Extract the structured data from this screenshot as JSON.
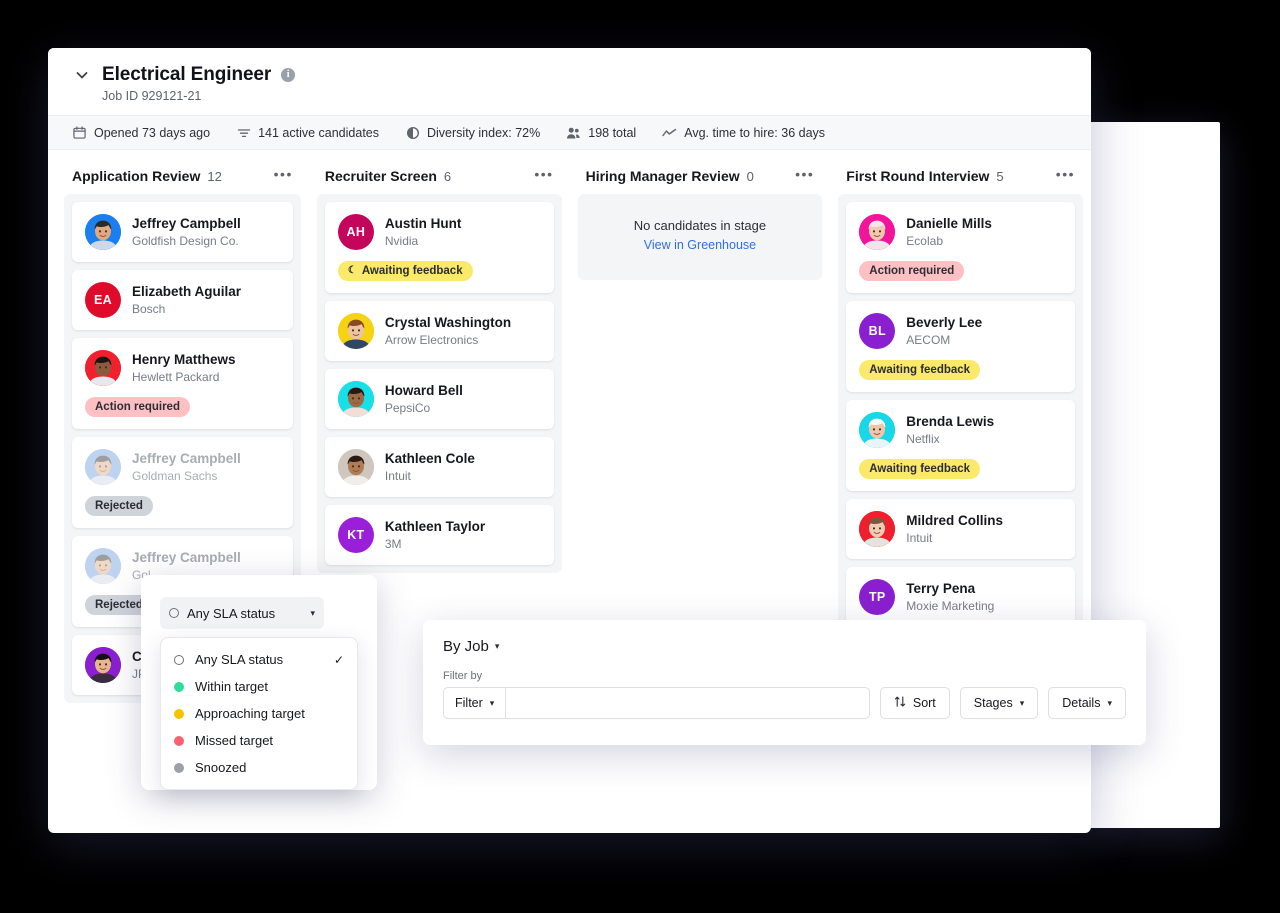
{
  "header": {
    "title": "Electrical Engineer",
    "job_id": "Job ID 929121-21",
    "info_glyph": "i",
    "chevron": "chevron-down"
  },
  "stats": [
    {
      "icon": "calendar-icon",
      "label": "Opened 73 days ago"
    },
    {
      "icon": "filter-icon",
      "label": "141 active candidates"
    },
    {
      "icon": "diversity-icon",
      "label": "Diversity index: 72%"
    },
    {
      "icon": "people-icon",
      "label": "198 total"
    },
    {
      "icon": "trend-icon",
      "label": "Avg. time to hire: 36 days"
    }
  ],
  "columns": [
    {
      "name": "Application Review",
      "count": "12",
      "menu": "•••",
      "empty": null,
      "cards": [
        {
          "name": "Jeffrey Campbell",
          "company": "Goldfish Design Co.",
          "initials": "",
          "avatar_color": "#1b7ff0",
          "photo": "male-1",
          "badge": null,
          "badge_type": null,
          "dim": false
        },
        {
          "name": "Elizabeth Aguilar",
          "company": "Bosch",
          "initials": "EA",
          "avatar_color": "#e00b2a",
          "photo": null,
          "badge": null,
          "badge_type": null,
          "dim": false
        },
        {
          "name": "Henry Matthews",
          "company": "Hewlett Packard",
          "initials": "",
          "avatar_color": "#f0202f",
          "photo": "male-2",
          "badge": "Action required",
          "badge_type": "action",
          "dim": false
        },
        {
          "name": "Jeffrey Campbell",
          "company": "Goldman Sachs",
          "initials": "",
          "avatar_color": "#6f9fe0",
          "photo": "male-1",
          "badge": "Rejected",
          "badge_type": "reject",
          "dim": true
        },
        {
          "name": "Jeffrey Campbell",
          "company": "Gol",
          "initials": "",
          "avatar_color": "#6f9fe0",
          "photo": "male-1",
          "badge": "Rejected",
          "badge_type": "reject",
          "dim": true
        },
        {
          "name": "Cat",
          "company": "JPM",
          "initials": "",
          "avatar_color": "#8a1fd0",
          "photo": "female-1",
          "badge": null,
          "badge_type": null,
          "dim": false
        }
      ]
    },
    {
      "name": "Recruiter Screen",
      "count": "6",
      "menu": "•••",
      "empty": null,
      "cards": [
        {
          "name": "Austin Hunt",
          "company": "Nvidia",
          "initials": "AH",
          "avatar_color": "#c4055c",
          "photo": null,
          "badge": "Awaiting feedback",
          "badge_type": "await",
          "badge_icon": "☾",
          "dim": false
        },
        {
          "name": "Crystal Washington",
          "company": "Arrow Electronics",
          "initials": "",
          "avatar_color": "#f5d312",
          "photo": "female-2",
          "badge": null,
          "badge_type": null,
          "dim": false
        },
        {
          "name": "Howard Bell",
          "company": "PepsiCo",
          "initials": "",
          "avatar_color": "#18e0e8",
          "photo": "male-3",
          "badge": null,
          "badge_type": null,
          "dim": false
        },
        {
          "name": "Kathleen Cole",
          "company": "Intuit",
          "initials": "",
          "avatar_color": "#cfc6bd",
          "photo": "female-3",
          "badge": null,
          "badge_type": null,
          "dim": false
        },
        {
          "name": "Kathleen Taylor",
          "company": "3M",
          "initials": "KT",
          "avatar_color": "#9a1fd8",
          "photo": null,
          "badge": null,
          "badge_type": null,
          "dim": false
        }
      ]
    },
    {
      "name": "Hiring Manager Review",
      "count": "0",
      "menu": "•••",
      "empty": {
        "message": "No candidates in stage",
        "link": "View in Greenhouse"
      },
      "cards": []
    },
    {
      "name": "First Round Interview",
      "count": "5",
      "menu": "•••",
      "empty": null,
      "cards": [
        {
          "name": "Danielle Mills",
          "company": "Ecolab",
          "initials": "",
          "avatar_color": "#f2149b",
          "photo": "female-4",
          "badge": "Action required",
          "badge_type": "action",
          "dim": false
        },
        {
          "name": "Beverly Lee",
          "company": "AECOM",
          "initials": "BL",
          "avatar_color": "#8a1fd0",
          "photo": null,
          "badge": "Awaiting feedback",
          "badge_type": "await",
          "dim": false
        },
        {
          "name": "Brenda Lewis",
          "company": "Netflix",
          "initials": "",
          "avatar_color": "#18d7e8",
          "photo": "female-5",
          "badge": "Awaiting feedback",
          "badge_type": "await",
          "dim": false
        },
        {
          "name": "Mildred Collins",
          "company": "Intuit",
          "initials": "",
          "avatar_color": "#ef1f2e",
          "photo": "female-6",
          "badge": null,
          "badge_type": null,
          "dim": false
        },
        {
          "name": "Terry Pena",
          "company": "Moxie Marketing",
          "initials": "TP",
          "avatar_color": "#8a1fd0",
          "photo": null,
          "badge": null,
          "badge_type": null,
          "dim": false
        }
      ]
    }
  ],
  "sla": {
    "trigger_label": "Any SLA status",
    "caret": "▾",
    "check": "✓",
    "options": [
      {
        "label": "Any SLA status",
        "marker": "ring",
        "color": "",
        "selected": true
      },
      {
        "label": "Within target",
        "marker": "dot",
        "color": "#2fdd9b",
        "selected": false
      },
      {
        "label": "Approaching target",
        "marker": "dot",
        "color": "#f5c400",
        "selected": false
      },
      {
        "label": "Missed target",
        "marker": "dot",
        "color": "#fa6273",
        "selected": false
      },
      {
        "label": "Snoozed",
        "marker": "dot",
        "color": "#9ba1a9",
        "selected": false
      }
    ]
  },
  "filter_panel": {
    "by_job": "By Job",
    "by_job_caret": "▾",
    "filter_by_label": "Filter by",
    "filter_button": "Filter",
    "filter_caret": "▾",
    "search_value": "",
    "search_placeholder": "",
    "sort_button": "Sort",
    "sort_icon": "↑↓",
    "stages_button": "Stages",
    "stages_caret": "▾",
    "details_button": "Details",
    "details_caret": "▾"
  }
}
